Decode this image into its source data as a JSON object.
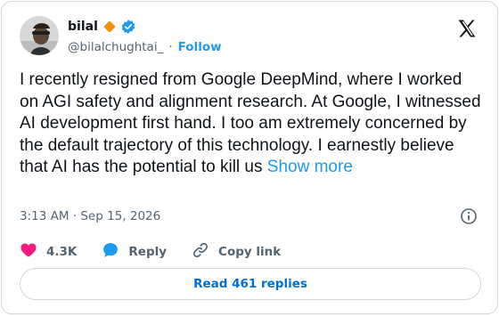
{
  "author": {
    "name": "bilal",
    "handle": "@bilalchughtai_",
    "separator": "·",
    "follow_label": "Follow",
    "badge_icon": "orange-diamond-icon",
    "verified_icon": "verified-check-icon"
  },
  "tweet": {
    "text": "I recently resigned from Google DeepMind, where I worked on AGI safety and alignment research. At Google, I witnessed AI development first hand. I too am extremely concerned by the default trajectory of this technology. I earnestly believe that AI has the potential to kill us",
    "show_more": "Show more",
    "timestamp": "3:13 AM · Sep 15, 2026"
  },
  "actions": {
    "likes": "4.3K",
    "reply": "Reply",
    "copy_link": "Copy link"
  },
  "replies_button": "Read 461 replies",
  "colors": {
    "accent": "#1d9bf0",
    "like": "#f91880",
    "badge": "#f4900c",
    "text": "#0f1419",
    "muted": "#536471"
  }
}
